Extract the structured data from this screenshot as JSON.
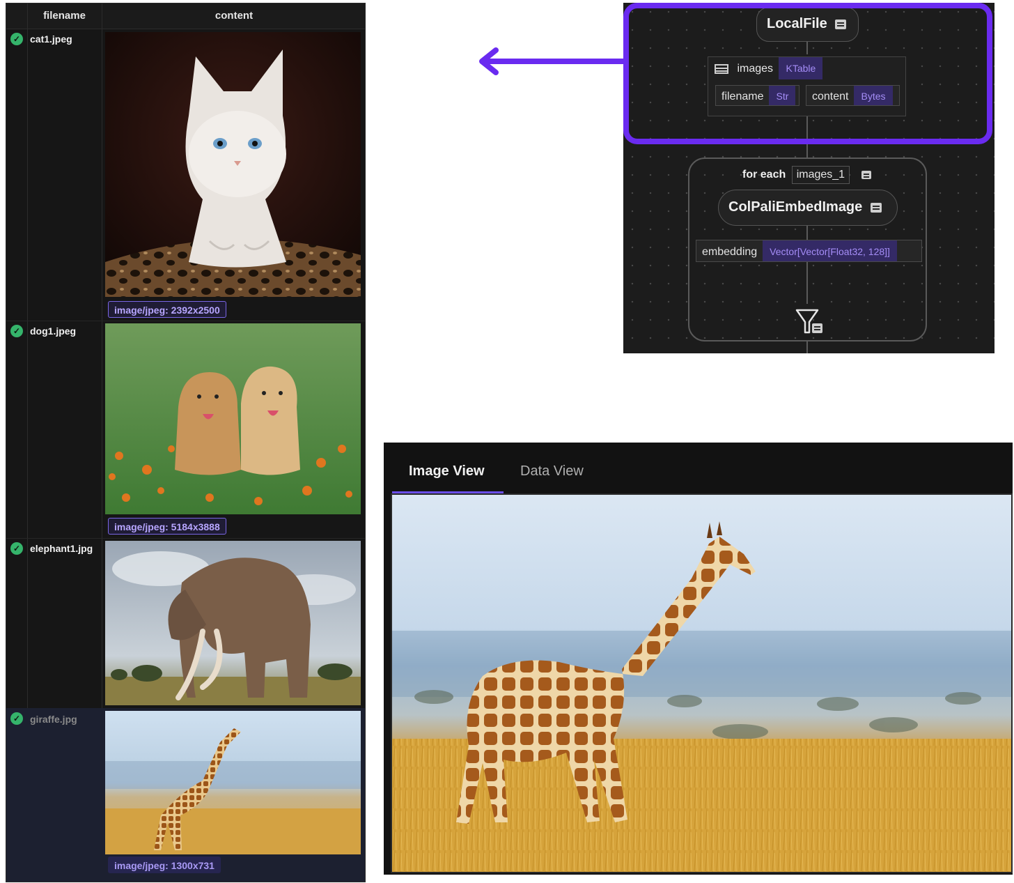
{
  "table": {
    "headers": {
      "filename": "filename",
      "content": "content"
    },
    "rows": [
      {
        "filename": "cat1.jpeg",
        "mime": "image/jpeg: 2392x2500"
      },
      {
        "filename": "dog1.jpeg",
        "mime": "image/jpeg: 5184x3888"
      },
      {
        "filename": "elephant1.jpg",
        "mime": ""
      },
      {
        "filename": "giraffe.jpg",
        "mime": "image/jpeg: 1300x731"
      }
    ]
  },
  "graph": {
    "source_node": "LocalFile",
    "collection": {
      "name": "images",
      "type": "KTable"
    },
    "fields": [
      {
        "name": "filename",
        "type": "Str"
      },
      {
        "name": "content",
        "type": "Bytes"
      }
    ],
    "foreach": {
      "label": "for each",
      "var": "images_1"
    },
    "transform_node": "ColPaliEmbedImage",
    "output": {
      "name": "embedding",
      "type": "Vector[Vector[Float32, 128]]"
    }
  },
  "viewer": {
    "tabs": [
      "Image View",
      "Data View"
    ],
    "active_tab": "Image View"
  },
  "colors": {
    "accent": "#6a2bf0",
    "status_ok": "#35b46b",
    "type_badge": "#a58df7"
  },
  "icons": [
    "check-circle-icon",
    "table-icon",
    "document-icon",
    "filter-icon",
    "arrow-left-icon"
  ]
}
